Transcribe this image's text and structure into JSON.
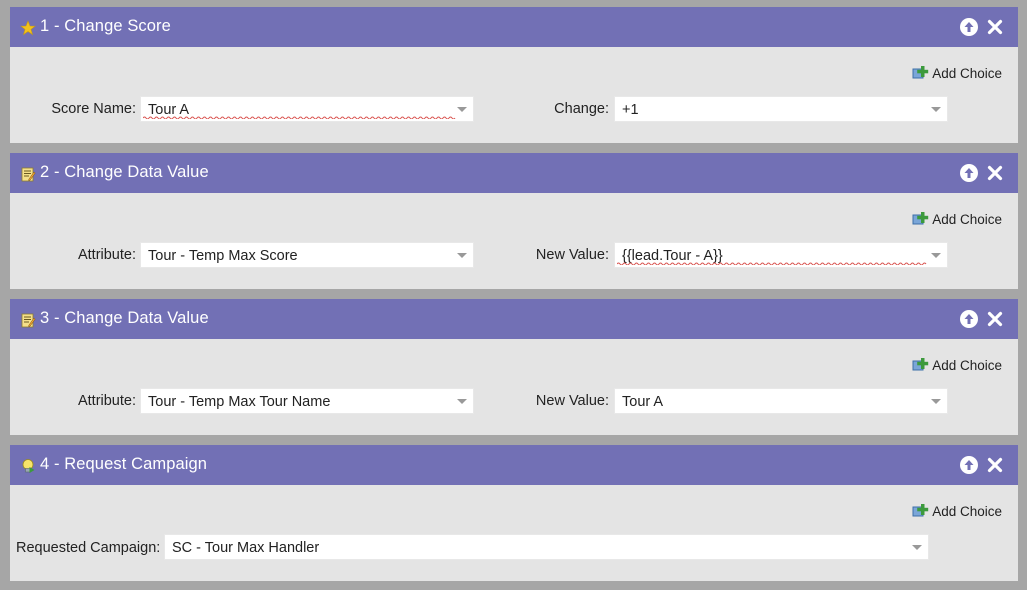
{
  "steps": [
    {
      "title": "1 - Change Score",
      "icon": "star-icon",
      "add_choice": "Add Choice",
      "fields": [
        {
          "label": "Score Name:",
          "value": "Tour A",
          "spellcheck": true
        },
        {
          "label": "Change:",
          "value": "+1",
          "spellcheck": false
        }
      ]
    },
    {
      "title": "2 - Change Data Value",
      "icon": "data-value-icon",
      "add_choice": "Add Choice",
      "fields": [
        {
          "label": "Attribute:",
          "value": "Tour - Temp Max Score",
          "spellcheck": false
        },
        {
          "label": "New Value:",
          "value": "{{lead.Tour - A}}",
          "spellcheck": true
        }
      ]
    },
    {
      "title": "3 - Change Data Value",
      "icon": "data-value-icon",
      "add_choice": "Add Choice",
      "fields": [
        {
          "label": "Attribute:",
          "value": "Tour - Temp Max Tour Name",
          "spellcheck": false
        },
        {
          "label": "New Value:",
          "value": "Tour A",
          "spellcheck": false
        }
      ]
    },
    {
      "title": "4 - Request Campaign",
      "icon": "lightbulb-icon",
      "add_choice": "Add Choice",
      "fields": [
        {
          "label": "Requested Campaign:",
          "value": "SC - Tour Max Handler",
          "spellcheck": false
        }
      ]
    }
  ],
  "colors": {
    "header": "#7270b5",
    "body": "#e4e4e4",
    "background": "#a6a6a6",
    "star": "#f2c21b",
    "add_choice_plus": "#3c9a3c",
    "spellcheck_underline": "#d9534f"
  }
}
